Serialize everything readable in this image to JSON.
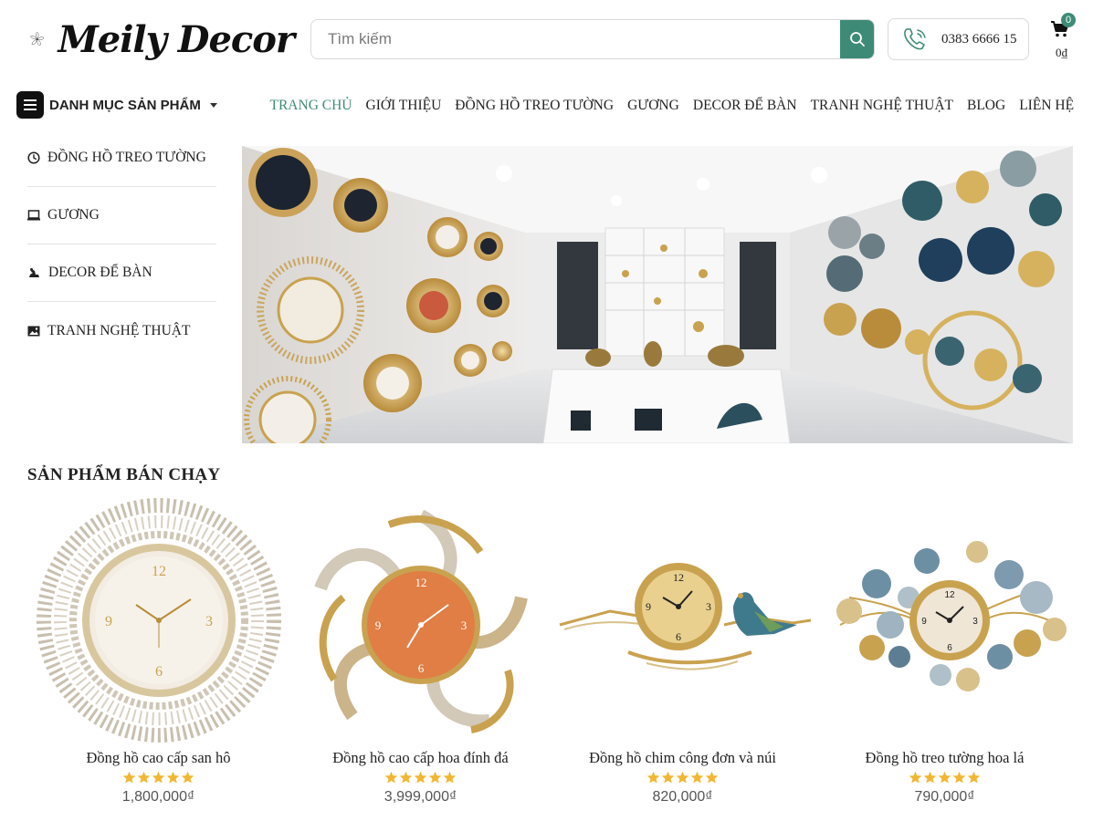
{
  "header": {
    "logo_text": "Meily Decor",
    "search_placeholder": "Tìm kiếm",
    "hotline": "0383 6666 15",
    "cart_count": "0",
    "cart_total": "0₫"
  },
  "nav": {
    "category_label": "DANH MỤC SẢN PHẨM",
    "items": [
      "TRANG CHỦ",
      "GIỚI THIỆU",
      "ĐỒNG HỒ TREO TƯỜNG",
      "GƯƠNG",
      "DECOR ĐỂ BÀN",
      "TRANH NGHỆ THUẬT",
      "BLOG",
      "LIÊN HỆ"
    ],
    "active_index": 0
  },
  "sidebar": {
    "items": [
      {
        "label": "ĐỒNG HỒ TREO TƯỜNG",
        "icon": "clock-icon"
      },
      {
        "label": "GƯƠNG",
        "icon": "mirror-icon"
      },
      {
        "label": "DECOR ĐỂ BÀN",
        "icon": "decor-icon"
      },
      {
        "label": "TRANH NGHỆ THUẬT",
        "icon": "image-icon"
      }
    ]
  },
  "section": {
    "title": "SẢN PHẨM BÁN CHẠY"
  },
  "products": [
    {
      "name": "Đồng hồ cao cấp san hô",
      "price": "1,800,000₫",
      "rating": 5
    },
    {
      "name": "Đồng hồ cao cấp hoa đính đá",
      "price": "3,999,000₫",
      "rating": 5
    },
    {
      "name": "Đồng hồ chim công đơn và núi",
      "price": "820,000₫",
      "rating": 5
    },
    {
      "name": "Đồng hồ treo tường hoa lá",
      "price": "790,000₫",
      "rating": 5
    }
  ],
  "colors": {
    "accent": "#3d8b76",
    "star": "#f2b632"
  }
}
